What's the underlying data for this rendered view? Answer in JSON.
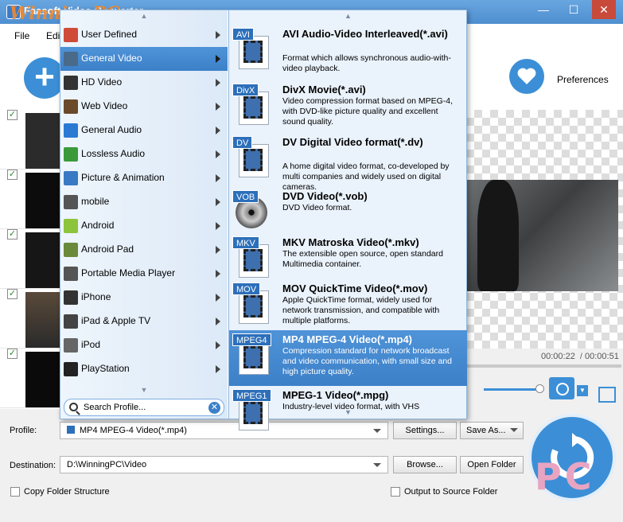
{
  "window": {
    "title": "Faasoft Video Converter",
    "watermark": "WinningPC",
    "minimize": "—",
    "maximize": "☐",
    "close": "✕"
  },
  "menu": {
    "items": [
      "File",
      "Edit"
    ]
  },
  "toolbar": {
    "add_icon": "+",
    "preferences_label": "Preferences"
  },
  "categories": [
    {
      "label": "User Defined",
      "icon": "user-icon",
      "color": "#d04a3a"
    },
    {
      "label": "General Video",
      "icon": "film-icon",
      "color": "#4a6a8a"
    },
    {
      "label": "HD Video",
      "icon": "hd-icon",
      "color": "#333333"
    },
    {
      "label": "Web Video",
      "icon": "globe-icon",
      "color": "#6a4a2a"
    },
    {
      "label": "General Audio",
      "icon": "note-icon",
      "color": "#2a7ad4"
    },
    {
      "label": "Lossless Audio",
      "icon": "music-icon",
      "color": "#3a9a3a"
    },
    {
      "label": "Picture & Animation",
      "icon": "picture-icon",
      "color": "#3a7ac4"
    },
    {
      "label": "mobile",
      "icon": "mobile-icon",
      "color": "#555555"
    },
    {
      "label": "Android",
      "icon": "android-icon",
      "color": "#8cc43c"
    },
    {
      "label": "Android Pad",
      "icon": "android-pad-icon",
      "color": "#6a8a3a"
    },
    {
      "label": "Portable Media Player",
      "icon": "player-icon",
      "color": "#555555"
    },
    {
      "label": "iPhone",
      "icon": "iphone-icon",
      "color": "#333333"
    },
    {
      "label": "iPad & Apple TV",
      "icon": "ipad-icon",
      "color": "#444444"
    },
    {
      "label": "iPod",
      "icon": "ipod-icon",
      "color": "#666666"
    },
    {
      "label": "PlayStation",
      "icon": "playstation-icon",
      "color": "#222222"
    }
  ],
  "selected_category": "General Video",
  "search": {
    "placeholder": "Search Profile...",
    "clear": "✕"
  },
  "formats": [
    {
      "tag": "AVI",
      "title": "AVI Audio-Video Interleaved(*.avi)",
      "desc": "Format which allows synchronous audio-with-video playback."
    },
    {
      "tag": "DivX",
      "title": "DivX Movie(*.avi)",
      "desc": "Video compression format based on MPEG-4, with DVD-like picture quality and excellent sound quality."
    },
    {
      "tag": "DV",
      "title": "DV Digital Video format(*.dv)",
      "desc": "A home digital video format, co-developed by multi companies and widely used on digital cameras."
    },
    {
      "tag": "VOB",
      "title": "DVD Video(*.vob)",
      "desc": "DVD Video format."
    },
    {
      "tag": "MKV",
      "title": "MKV Matroska Video(*.mkv)",
      "desc": "The extensible open source, open standard Multimedia container."
    },
    {
      "tag": "MOV",
      "title": "MOV QuickTime Video(*.mov)",
      "desc": "Apple QuickTime format, widely used for network transmission, and compatible with multiple platforms."
    },
    {
      "tag": "MPEG4",
      "title": "MP4 MPEG-4 Video(*.mp4)",
      "desc": "Compression standard for network broadcast and video communication, with small size and high picture quality."
    },
    {
      "tag": "MPEG1",
      "title": "MPEG-1 Video(*.mpg)",
      "desc": "Industry-level video format, with VHS"
    }
  ],
  "selected_format": "MP4 MPEG-4 Video(*.mp4)",
  "preview": {
    "current_time": "00:00:22",
    "total_time": "00:00:51"
  },
  "profile": {
    "label": "Profile:",
    "value": "MP4 MPEG-4 Video(*.mp4)",
    "settings_button": "Settings...",
    "save_as_button": "Save As..."
  },
  "destination": {
    "label": "Destination:",
    "value": "D:\\WinningPC\\Video",
    "browse_button": "Browse...",
    "open_folder_button": "Open Folder"
  },
  "options": {
    "copy_folder_structure": "Copy Folder Structure",
    "output_to_source_folder": "Output to Source Folder"
  },
  "overlay_watermark": "PC",
  "colors": {
    "accent": "#3c8fd6",
    "selection": "#4f93d8"
  }
}
